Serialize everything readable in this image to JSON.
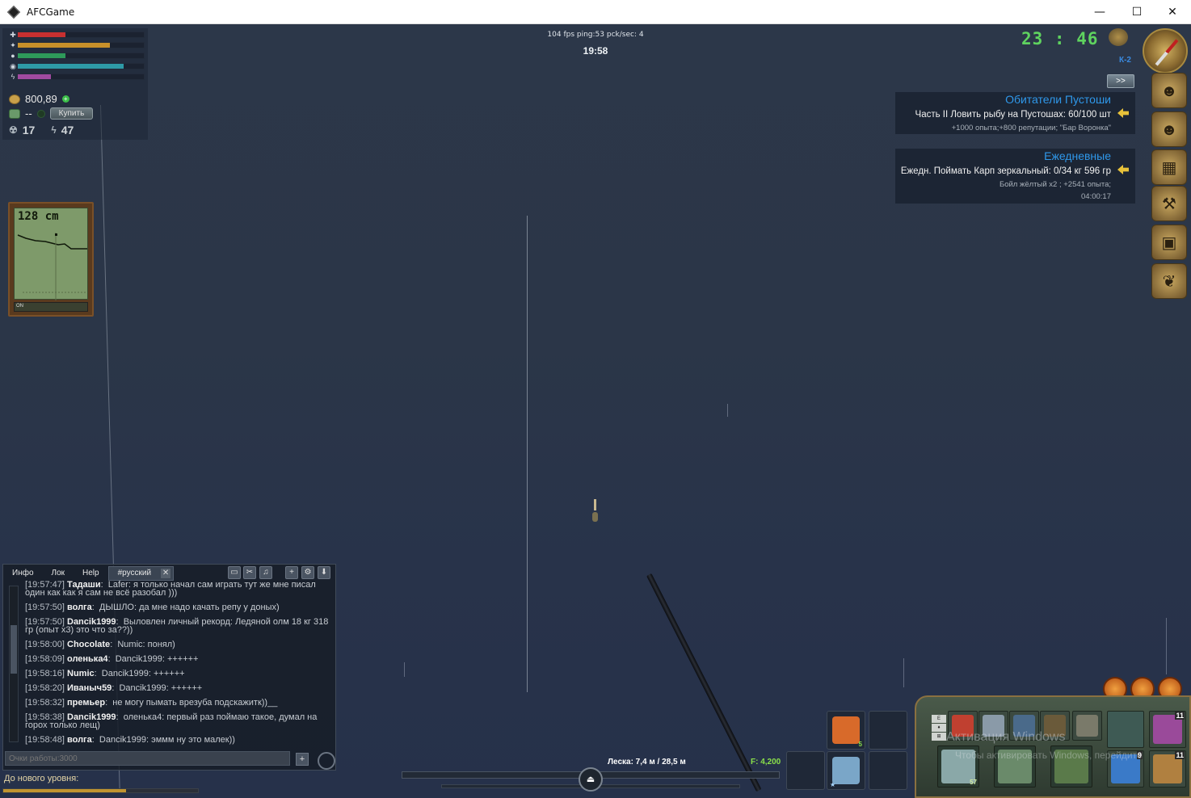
{
  "window": {
    "title": "AFCGame",
    "minimize": "—",
    "maximize": "☐",
    "close": "✕"
  },
  "hud": {
    "fps": "104 fps ping:53 pck/sec: 4",
    "server_time": "19:58",
    "game_clock": "23 : 46",
    "zone": "К-2",
    "expand_label": ">>",
    "bars": [
      {
        "name": "health",
        "fill": 0.38,
        "color": "#c83030"
      },
      {
        "name": "hunger",
        "fill": 0.73,
        "color": "#c8902a"
      },
      {
        "name": "thirst",
        "fill": 0.38,
        "color": "#2e9a5a"
      },
      {
        "name": "fatigue",
        "fill": 0.84,
        "color": "#2e9aa6"
      },
      {
        "name": "energy",
        "fill": 0.26,
        "color": "#a04aa0"
      }
    ],
    "money": "800,89",
    "gold": "--",
    "buy_label": "Купить",
    "radiation": "17",
    "energy_value": "47"
  },
  "sonar": {
    "depth": "128 cm",
    "toggle": "ON"
  },
  "quests": [
    {
      "title": "Обитатели Пустоши",
      "task": "Часть II Ловить рыбу на Пустошах: 60/100 шт",
      "reward": "+1000 опыта;+800 репутации; \"Бар Воронка\"",
      "timer": ""
    },
    {
      "title": "Ежедневные",
      "task": "Ежедн. Поймать Карп зеркальный: 0/34 кг 596 гр",
      "reward": "Бойл жёлтый x2 ; +2541 опыта;",
      "timer": "04:00:17"
    }
  ],
  "chat": {
    "tabs": [
      "Инфо",
      "Лок",
      "Help"
    ],
    "active_tab": "#русский",
    "close_label": "✕",
    "tools": [
      "▭",
      "✂",
      "♫",
      "+",
      "⚙",
      "⬇"
    ],
    "messages": [
      {
        "time": "[19:57:47]",
        "nick": "Тадаши",
        "text": "Lafer: я только начал сам играть тут же мне писал один как как я сам не всё разобал )))"
      },
      {
        "time": "[19:57:50]",
        "nick": "волга",
        "text": "ДЫШЛО: да мне надо качать репу у доных)"
      },
      {
        "time": "[19:57:50]",
        "nick": "Dancik1999",
        "text": "Выловлен личный рекорд: Ледяной олм 18 кг 318 гр (опыт x3) это что за??))"
      },
      {
        "time": "[19:58:00]",
        "nick": "Chocolate",
        "text": "Numic: понял)"
      },
      {
        "time": "[19:58:09]",
        "nick": "оленька4",
        "text": "Dancik1999: ++++++"
      },
      {
        "time": "[19:58:16]",
        "nick": "Numic",
        "text": "Dancik1999: ++++++"
      },
      {
        "time": "[19:58:20]",
        "nick": "Иваныч59",
        "text": "Dancik1999: ++++++"
      },
      {
        "time": "[19:58:32]",
        "nick": "премьер",
        "text": "не могу пымать врезуба подскажитк))__"
      },
      {
        "time": "[19:58:38]",
        "nick": "Dancik1999",
        "text": "оленька4: первый раз поймаю такое, думал на горох только лещ)"
      },
      {
        "time": "[19:58:48]",
        "nick": "волга",
        "text": "Dancik1999: эммм ну это малек))"
      }
    ],
    "input_placeholder": "Очки работы:3000",
    "send_label": "+"
  },
  "level": {
    "label": "До нового уровня:",
    "progress": 0.63
  },
  "fishing": {
    "line": "Леска: 7,4 м / 28,5 м",
    "force": "F: 4,200",
    "reel_label": "⏏"
  },
  "quick_slots": [
    {
      "icon": "medkit-icon",
      "count": "5",
      "color": "#d86a2a"
    },
    {
      "icon": "water-bottle-icon",
      "count": "",
      "color": "#7aa6c8",
      "star": "★"
    }
  ],
  "equipment": {
    "tabs": [
      "E",
      "♦",
      "⊞"
    ],
    "top": [
      {
        "icon": "float-icon",
        "color": "#c04030"
      },
      {
        "icon": "lure-icon",
        "color": "#8a9aa8"
      },
      {
        "icon": "phone-icon",
        "color": "#4a6a8a"
      },
      {
        "icon": "rod-stand-icon",
        "color": "#6a5a3a"
      },
      {
        "icon": "bucket-icon",
        "color": "#7a7a6a"
      }
    ],
    "bottom": [
      {
        "icon": "fish-icon",
        "color": "#8aa8a8",
        "count": "57"
      },
      {
        "icon": "hook-icon",
        "color": "#6a8a6a",
        "count": ""
      },
      {
        "icon": "rod-icon",
        "color": "#5a7a4a",
        "count": ""
      }
    ],
    "side": [
      {
        "icon": "reel-icon",
        "color": "#9a4a9a",
        "badge": "11"
      },
      {
        "icon": "line-spool-icon",
        "color": "#3a7ac8",
        "badge": "9"
      },
      {
        "icon": "rod-case-icon",
        "color": "#b08040",
        "badge": "11"
      }
    ]
  },
  "watermark": {
    "title": "Активация Windows",
    "subtitle": "Чтобы активировать Windows, перейдите"
  }
}
